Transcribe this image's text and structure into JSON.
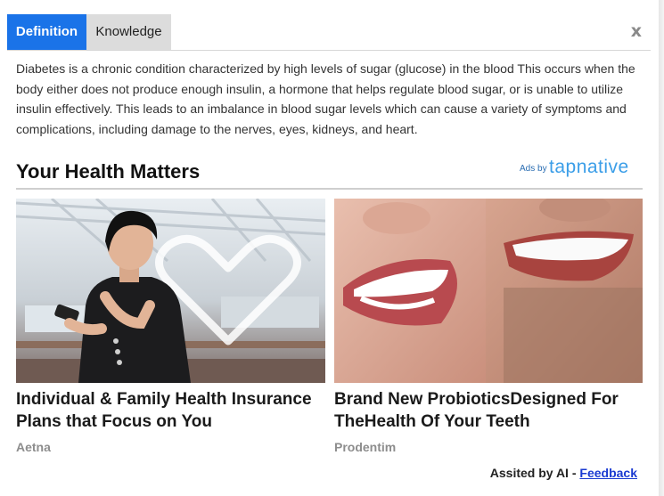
{
  "tabs": {
    "definition": "Definition",
    "knowledge": "Knowledge",
    "close": "x"
  },
  "definition_text": "Diabetes is a chronic condition characterized by high levels of sugar (glucose) in the blood This occurs when the body either does not produce enough insulin, a hormone that helps regulate blood sugar, or is unable to utilize insulin effectively. This leads to an imbalance in blood sugar levels which can cause a variety of symptoms and complications, including damage to the nerves, eyes, kidneys, and heart.",
  "section": {
    "title": "Your Health Matters",
    "ads_by": "Ads by",
    "brand": "tapnative"
  },
  "ads": [
    {
      "title": "Individual & Family Health Insurance Plans that Focus on You",
      "source": "Aetna",
      "icon": "heart-outline-icon"
    },
    {
      "title": "Brand New ProbioticsDesigned For TheHealth Of Your Teeth",
      "source": "Prodentim"
    }
  ],
  "footer": {
    "assisted": "Assited by AI -",
    "feedback": "Feedback"
  },
  "colors": {
    "accent": "#1a73e8",
    "tab_inactive": "#dcdcdc",
    "brand": "#3b9ee8",
    "link": "#1a3ad1"
  }
}
